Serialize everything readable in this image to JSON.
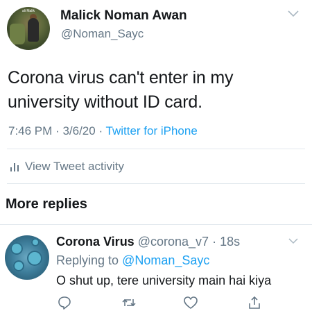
{
  "main_tweet": {
    "author_name": "Malick Noman Awan",
    "author_handle": "@Noman_Sayc",
    "avatar_caption": "ali Malik",
    "text_line1": "Corona virus can't enter in my",
    "text_line2": "university without ID card.",
    "time": "7:46 PM",
    "date": "3/6/20",
    "source": "Twitter for iPhone",
    "activity_label": "View Tweet activity"
  },
  "section": {
    "more_replies": "More replies"
  },
  "reply": {
    "author_name": "Corona Virus",
    "author_handle": "@corona_v7",
    "time_ago": "18s",
    "replying_prefix": "Replying to",
    "replying_to": "@Noman_Sayc",
    "text": "O shut up, tere university main hai kiya"
  },
  "icons": {
    "chevron": "chevron-down-icon",
    "activity": "bar-chart-icon",
    "reply": "reply-icon",
    "retweet": "retweet-icon",
    "like": "heart-icon",
    "share": "share-icon"
  },
  "colors": {
    "text": "#14171a",
    "muted": "#657786",
    "link": "#1da1f2",
    "divider": "#e1e8ed"
  }
}
